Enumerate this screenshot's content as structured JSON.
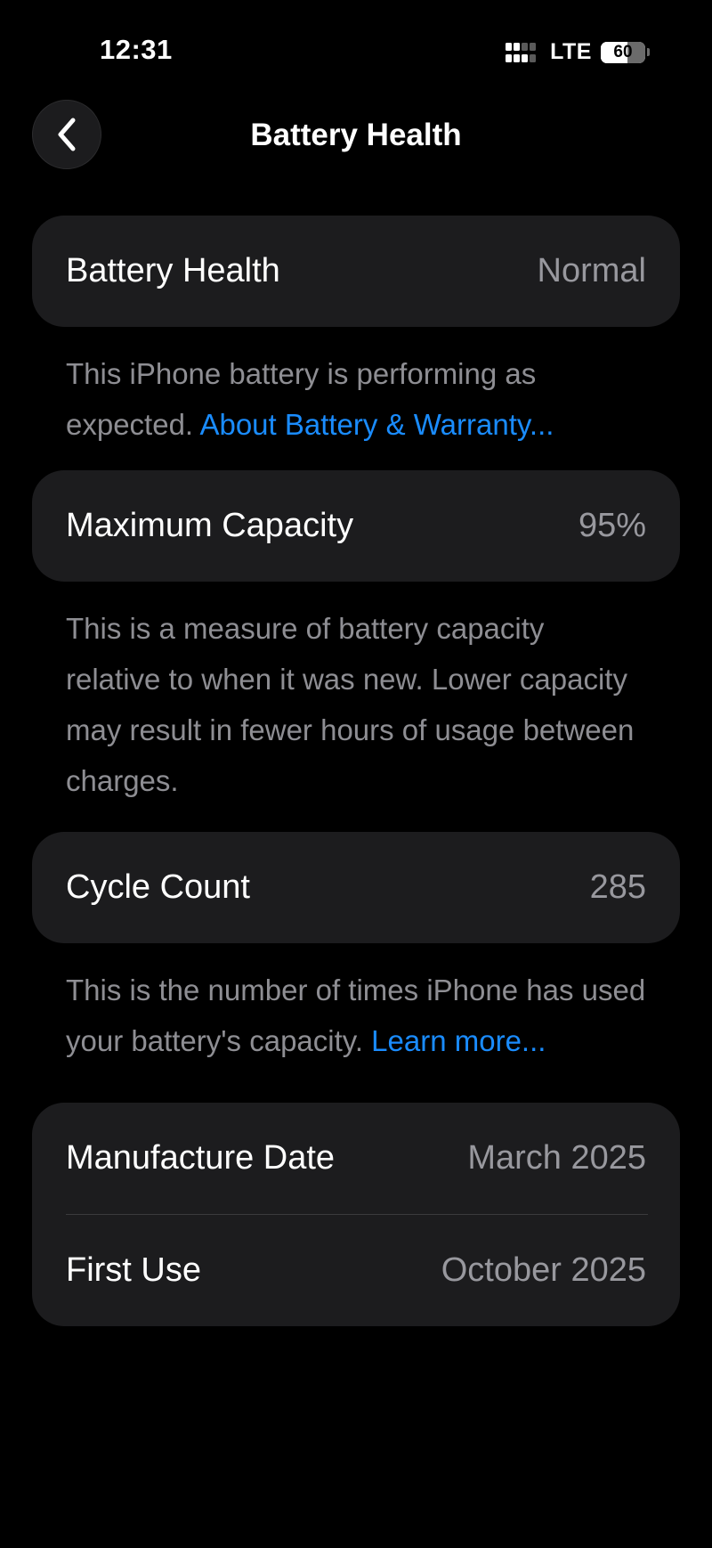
{
  "status_bar": {
    "time": "12:31",
    "network": "LTE",
    "battery_level": "60",
    "battery_fraction": 0.6,
    "signal_icon": "signal-bars-icon",
    "battery_icon": "battery-icon"
  },
  "nav": {
    "back_icon": "chevron-left-icon",
    "title": "Battery Health"
  },
  "sections": {
    "health": {
      "label": "Battery Health",
      "value": "Normal",
      "footnote_text": "This iPhone battery is performing as expected. ",
      "footnote_link": "About Battery & Warranty..."
    },
    "capacity": {
      "label": "Maximum Capacity",
      "value": "95%",
      "footnote_text": "This is a measure of battery capacity relative to when it was new. Lower capacity may result in fewer hours of usage between charges."
    },
    "cycles": {
      "label": "Cycle Count",
      "value": "285",
      "footnote_text": "This is the number of times iPhone has used your battery's capacity. ",
      "footnote_link": "Learn more..."
    },
    "dates": {
      "manufacture_label": "Manufacture Date",
      "manufacture_value": "March 2025",
      "first_use_label": "First Use",
      "first_use_value": "October 2025"
    }
  },
  "colors": {
    "background": "#000000",
    "card": "#1c1c1e",
    "secondary_text": "#8e8e93",
    "link": "#1a8cff"
  }
}
